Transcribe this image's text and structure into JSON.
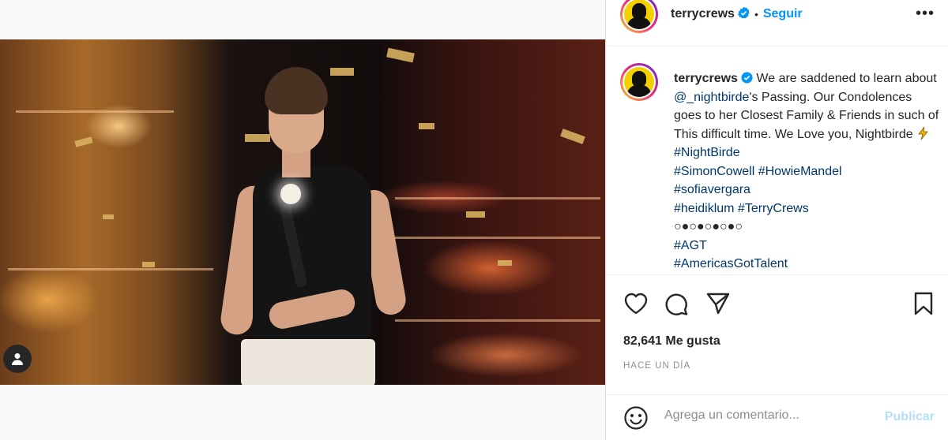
{
  "post": {
    "username": "terrycrews",
    "follow_label": "Seguir",
    "separator": "•",
    "more_label": "•••"
  },
  "caption": {
    "username": "terrycrews",
    "text_1": "We are saddened to learn about ",
    "mention": "@_nightbirde",
    "text_2": "'s Passing. Our Condolences goes to her Closest Family & Friends in such of This difficult time. We Love you, Nightbirde",
    "hashtags_inline": "#NightBirde",
    "lines": [
      "#SimonCowell #HowieMandel",
      "#sofiavergara",
      "#heidiklum #TerryCrews",
      "○●○●○●○●○",
      "#AGT",
      "#AmericasGotTalent"
    ]
  },
  "stats": {
    "likes": "82,641 Me gusta",
    "time": "HACE UN DÍA"
  },
  "comment": {
    "placeholder": "Agrega un comentario...",
    "publish_label": "Publicar"
  },
  "colors": {
    "accent": "#0095f6",
    "link": "#00376b",
    "publish_disabled": "#b2dffc",
    "avatar_bg": "#f5d000"
  },
  "icons": [
    "verified-badge-icon",
    "heart-icon",
    "comment-icon",
    "share-icon",
    "bookmark-icon",
    "emoji-icon",
    "user-tag-icon",
    "lightning-icon",
    "more-options-icon"
  ]
}
